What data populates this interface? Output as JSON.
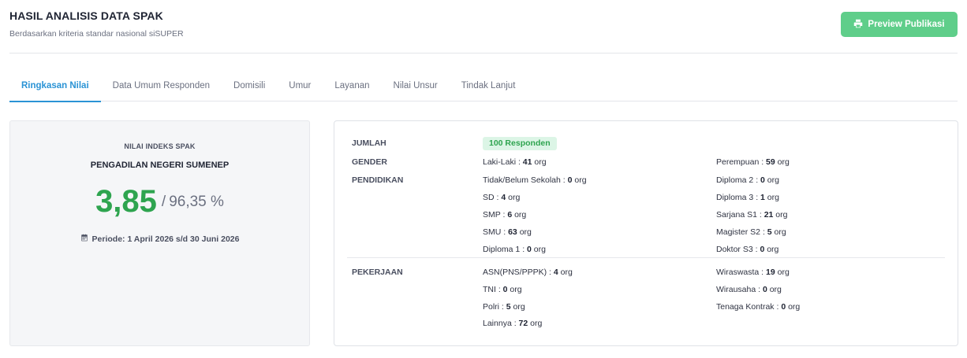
{
  "header": {
    "title": "HASIL ANALISIS DATA SPAK",
    "subtitle": "Berdasarkan kriteria standar nasional siSUPER",
    "preview_button": "Preview Publikasi",
    "preview_icon": "printer-icon"
  },
  "tabs": [
    {
      "label": "Ringkasan Nilai",
      "active": true
    },
    {
      "label": "Data Umum Responden",
      "active": false
    },
    {
      "label": "Domisili",
      "active": false
    },
    {
      "label": "Umur",
      "active": false
    },
    {
      "label": "Layanan",
      "active": false
    },
    {
      "label": "Nilai Unsur",
      "active": false
    },
    {
      "label": "Tindak Lanjut",
      "active": false
    }
  ],
  "summary": {
    "label": "NILAI INDEKS SPAK",
    "organization": "PENGADILAN NEGERI SUMENEP",
    "score": "3,85",
    "separator": "/",
    "percentage": "96,35 %",
    "period": "Periode: 1 April 2026 s/d 30 Juni 2026",
    "period_icon": "calendar-icon"
  },
  "details": {
    "jumlah_label": "JUMLAH",
    "jumlah_value": "100 Responden",
    "gender_label": "GENDER",
    "gender": [
      {
        "label": "Laki-Laki : ",
        "value": "41",
        "unit": " org"
      },
      {
        "label": "Perempuan : ",
        "value": "59",
        "unit": " org"
      }
    ],
    "pendidikan_label": "PENDIDIKAN",
    "pendidikan": [
      {
        "label": "Tidak/Belum Sekolah : ",
        "value": "0",
        "unit": " org"
      },
      {
        "label": "Diploma 2 : ",
        "value": "0",
        "unit": " org"
      },
      {
        "label": "SD : ",
        "value": "4",
        "unit": " org"
      },
      {
        "label": "Diploma 3 : ",
        "value": "1",
        "unit": " org"
      },
      {
        "label": "SMP : ",
        "value": "6",
        "unit": " org"
      },
      {
        "label": "Sarjana S1 : ",
        "value": "21",
        "unit": " org"
      },
      {
        "label": "SMU : ",
        "value": "63",
        "unit": " org"
      },
      {
        "label": "Magister S2 : ",
        "value": "5",
        "unit": " org"
      },
      {
        "label": "Diploma 1 : ",
        "value": "0",
        "unit": " org"
      },
      {
        "label": "Doktor S3 : ",
        "value": "0",
        "unit": " org"
      }
    ],
    "pekerjaan_label": "PEKERJAAN",
    "pekerjaan": [
      {
        "label": "ASN(PNS/PPPK) : ",
        "value": "4",
        "unit": " org"
      },
      {
        "label": "Wiraswasta : ",
        "value": "19",
        "unit": " org"
      },
      {
        "label": "TNI : ",
        "value": "0",
        "unit": " org"
      },
      {
        "label": "Wirausaha : ",
        "value": "0",
        "unit": " org"
      },
      {
        "label": "Polri : ",
        "value": "5",
        "unit": " org"
      },
      {
        "label": "Tenaga Kontrak : ",
        "value": "0",
        "unit": " org"
      },
      {
        "label": "Lainnya : ",
        "value": "72",
        "unit": " org"
      }
    ]
  },
  "colors": {
    "accent": "#2a93d5",
    "score_green": "#2ea44f",
    "button_green": "#5fce8a",
    "badge_bg": "#dcf5e6"
  }
}
